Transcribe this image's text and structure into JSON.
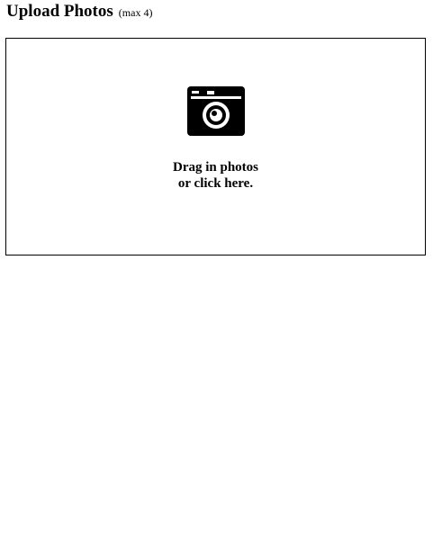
{
  "header": {
    "title": "Upload Photos",
    "subtitle": "(max 4)"
  },
  "dropzone": {
    "icon": "camera-icon",
    "line1": "Drag in photos",
    "line2": "or click here."
  }
}
